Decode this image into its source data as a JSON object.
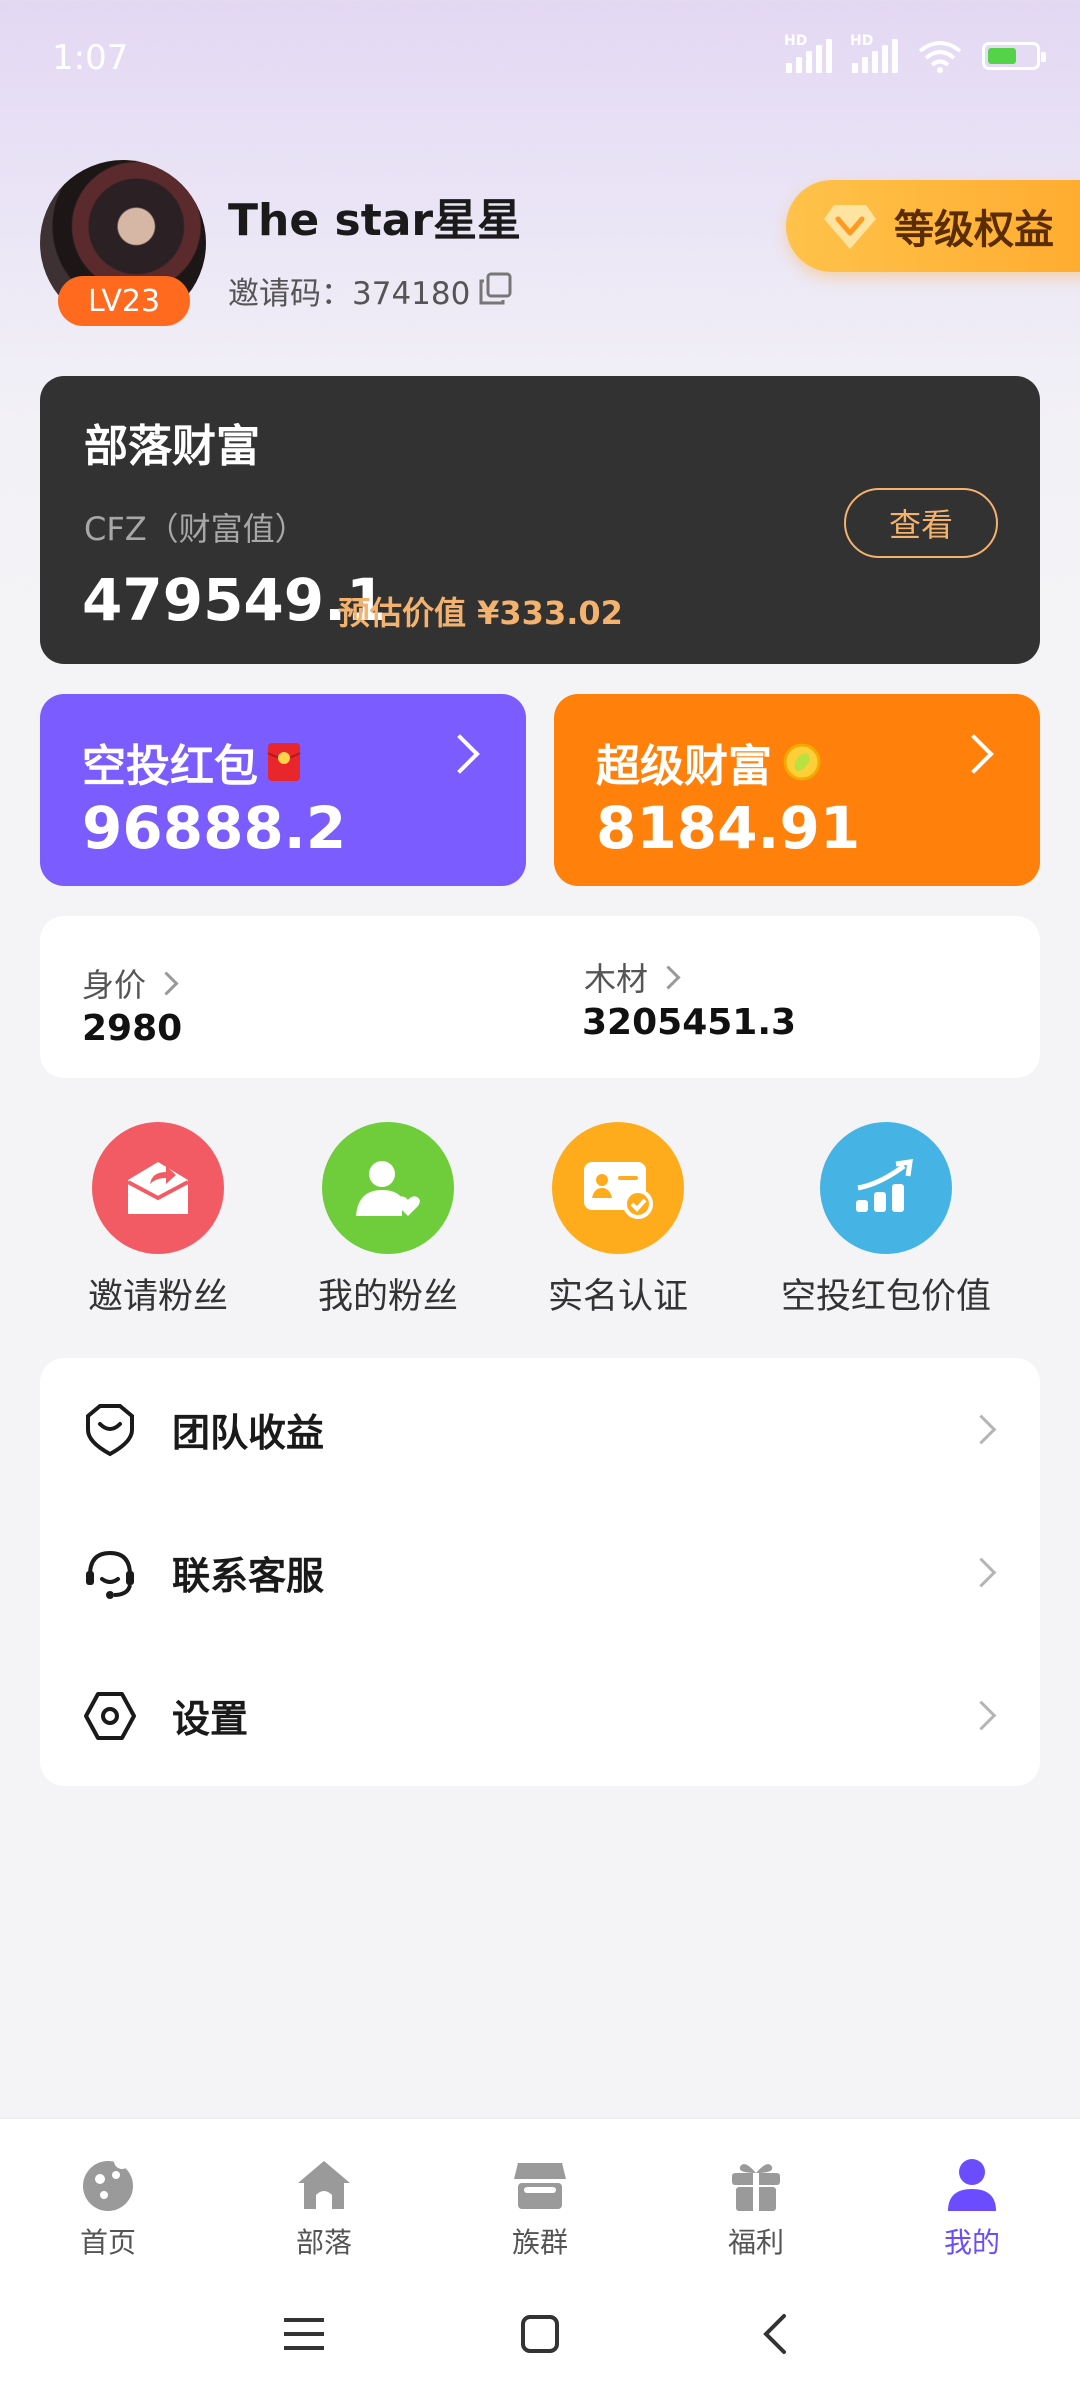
{
  "status_bar": {
    "time": "1:07",
    "hd_label": "HD"
  },
  "profile": {
    "level": "LV23",
    "username": "The star星星",
    "invite_code": "邀请码：374180",
    "level_rights_label": "等级权益"
  },
  "wealth_card": {
    "title": "部落财富",
    "subtitle": "CFZ（财富值）",
    "value": "479549.1",
    "estimate": "预估价值 ¥333.02",
    "view_button": "查看"
  },
  "airdrop": {
    "title": "空投红包",
    "value": "96888.2"
  },
  "super_wealth": {
    "title": "超级财富",
    "value": "8184.91"
  },
  "stats": [
    {
      "label": "身价",
      "value": "2980"
    },
    {
      "label": "木材",
      "value": "3205451.3"
    }
  ],
  "quick_actions": [
    {
      "label": "邀请粉丝",
      "icon": "invite-icon",
      "color": "#f25b63"
    },
    {
      "label": "我的粉丝",
      "icon": "fans-icon",
      "color": "#6fcd3c"
    },
    {
      "label": "实名认证",
      "icon": "id-card-icon",
      "color": "#ffac1c"
    },
    {
      "label": "空投红包价值",
      "icon": "trend-icon",
      "color": "#45b4e4"
    }
  ],
  "menu": [
    {
      "label": "团队收益",
      "icon": "heart-badge-icon"
    },
    {
      "label": "联系客服",
      "icon": "headset-icon"
    },
    {
      "label": "设置",
      "icon": "hexagon-gear-icon"
    }
  ],
  "bottom_nav": [
    {
      "label": "首页",
      "icon": "cookie-icon"
    },
    {
      "label": "部落",
      "icon": "house-icon"
    },
    {
      "label": "族群",
      "icon": "store-icon"
    },
    {
      "label": "福利",
      "icon": "gift-icon"
    },
    {
      "label": "我的",
      "icon": "person-icon",
      "active": true
    }
  ],
  "colors": {
    "accent": "#6b4dff",
    "orange": "#ff800a",
    "purple": "#7b5cff",
    "gold": "#f3b26d"
  }
}
